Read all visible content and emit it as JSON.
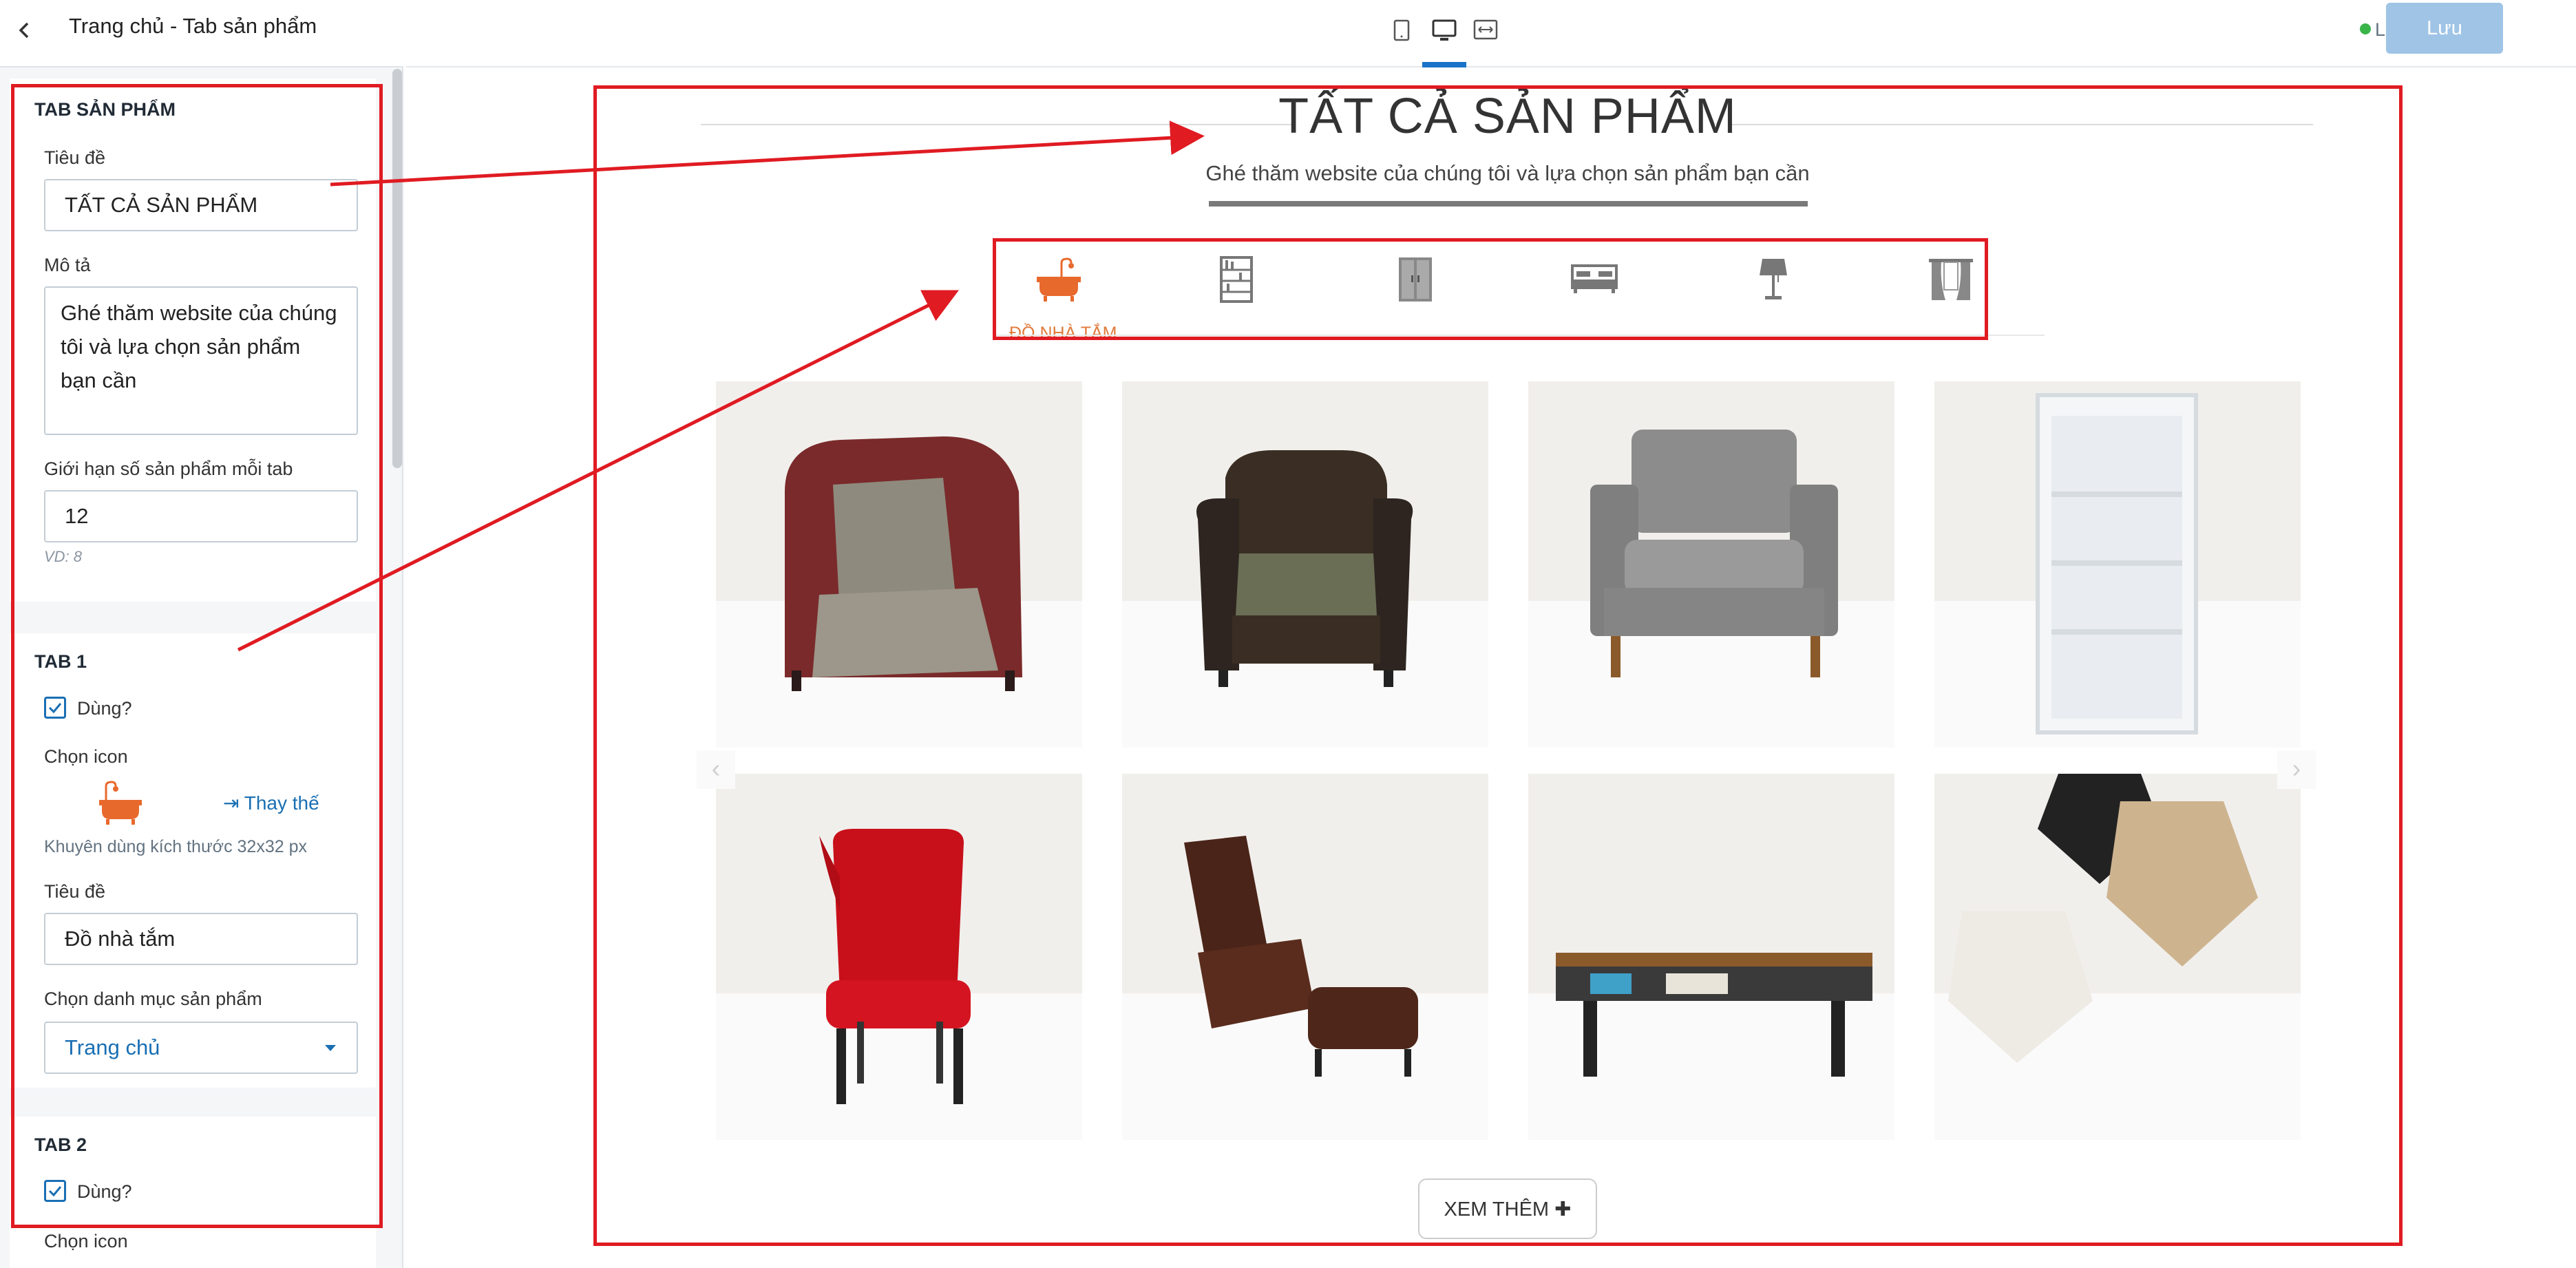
{
  "sidebar": {
    "title": "Trang chủ - Tab sản phẩm",
    "section": {
      "heading": "TAB SẢN PHẨM",
      "title_label": "Tiêu đề",
      "title_value": "TẤT CẢ SẢN PHẨM",
      "desc_label": "Mô tả",
      "desc_value": "Ghé thăm website của chúng tôi và lựa chọn sản phẩm bạn cần",
      "limit_label": "Giới hạn số sản phẩm mỗi tab",
      "limit_value": "12",
      "limit_hint": "VD: 8"
    },
    "tab1": {
      "heading": "TAB 1",
      "use_label": "Dùng?",
      "icon_label": "Chọn icon",
      "replace_label": "Thay thế",
      "icon_hint": "Khuyên dùng kích thước 32x32 px",
      "title_label": "Tiêu đề",
      "title_value": "Đồ nhà tắm",
      "category_label": "Chọn danh mục sản phẩm",
      "category_value": "Trang chủ"
    },
    "tab2": {
      "heading": "TAB 2",
      "use_label": "Dùng?",
      "icon_label": "Chọn icon"
    }
  },
  "topbar": {
    "devices": [
      "mobile-icon",
      "desktop-icon",
      "fullwidth-icon"
    ],
    "live_label": "Live",
    "save_label": "Lưu"
  },
  "preview": {
    "title": "TẤT CẢ SẢN PHẨM",
    "subtitle": "Ghé thăm website của chúng tôi và lựa chọn sản phẩm bạn cần",
    "tabs": [
      {
        "icon": "bathtub-icon",
        "label": "ĐỒ NHÀ TẮM",
        "active": true
      },
      {
        "icon": "bookshelf-icon"
      },
      {
        "icon": "wardrobe-icon"
      },
      {
        "icon": "bed-icon"
      },
      {
        "icon": "lamp-icon"
      },
      {
        "icon": "curtain-icon"
      }
    ],
    "products": [
      "armchair-wingback",
      "leather-armchair",
      "grey-armchair",
      "white-bookshelf",
      "red-chair",
      "brown-lounge-chair",
      "coffee-table",
      "pendant-lamps"
    ],
    "more_label": "XEM THÊM ✚"
  },
  "colors": {
    "annotation": "#e01b22",
    "accent": "#1a6fb3",
    "active_tab": "#e07a3a",
    "live": "#39b54a"
  }
}
